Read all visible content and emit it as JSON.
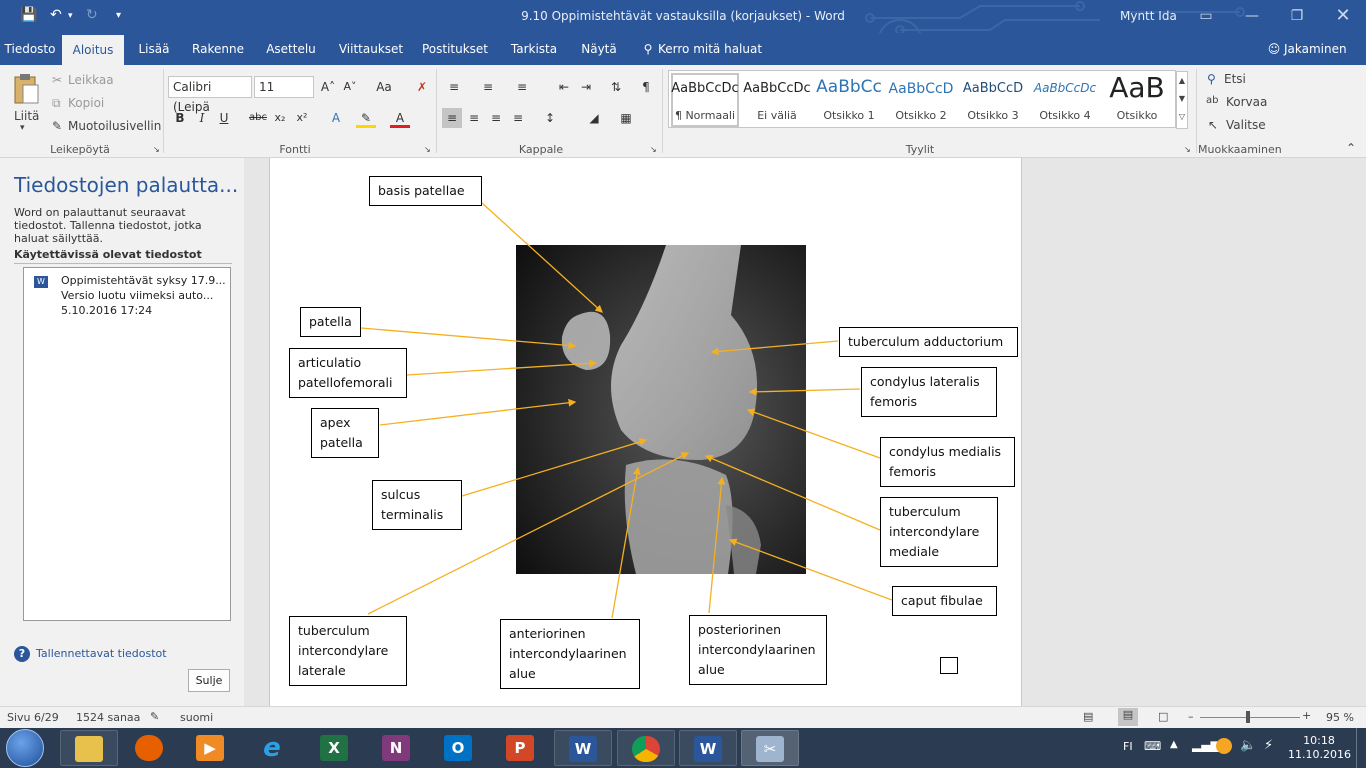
{
  "titlebar": {
    "title": "9.10 Oppimistehtävät vastauksilla (korjaukset) - Word",
    "user": "Myntt Ida",
    "save_icon": "save-icon",
    "undo_icon": "undo-icon",
    "redo_icon": "redo-icon"
  },
  "menu": {
    "tabs": [
      "Tiedosto",
      "Aloitus",
      "Lisää",
      "Rakenne",
      "Asettelu",
      "Viittaukset",
      "Postitukset",
      "Tarkista",
      "Näytä"
    ],
    "tell_me": "Kerro mitä haluat tehdä",
    "share": "Jakaminen",
    "active_tab": "Aloitus"
  },
  "ribbon": {
    "clipboard": {
      "paste": "Liitä",
      "cut": "Leikkaa",
      "copy": "Kopioi",
      "format_painter": "Muotoilusivellin",
      "label": "Leikepöytä"
    },
    "font": {
      "name": "Calibri (Leipä",
      "size": "11",
      "label": "Fontti",
      "change_case": "Aa"
    },
    "paragraph": {
      "label": "Kappale"
    },
    "styles": {
      "label": "Tyylit",
      "items": [
        {
          "preview": "AaBbCcDc",
          "name": "¶ Normaali",
          "color": "#000000"
        },
        {
          "preview": "AaBbCcDc",
          "name": "Ei väliä",
          "color": "#000000"
        },
        {
          "preview": "AaBbCc",
          "name": "Otsikko 1",
          "color": "#2e74b5"
        },
        {
          "preview": "AaBbCcD",
          "name": "Otsikko 2",
          "color": "#2e74b5"
        },
        {
          "preview": "AaBbCcD",
          "name": "Otsikko 3",
          "color": "#1f4e79"
        },
        {
          "preview": "AaBbCcDc",
          "name": "Otsikko 4",
          "color": "#2e74b5"
        },
        {
          "preview": "AaB",
          "name": "Otsikko",
          "color": "#000000"
        }
      ]
    },
    "editing": {
      "find": "Etsi",
      "replace": "Korvaa",
      "select": "Valitse",
      "label": "Muokkaaminen"
    }
  },
  "recovery": {
    "title": "Tiedostojen palautta...",
    "desc": "Word on palauttanut seuraavat tiedostot. Tallenna tiedostot, jotka haluat säilyttää.",
    "available_heading": "Käytettävissä olevat tiedostot",
    "file_name": "Oppimistehtävät syksy 17.9...",
    "file_version": "Versio luotu viimeksi auto...",
    "file_date": "5.10.2016 17:24",
    "help_link": "Tallennettavat tiedostot",
    "close_button": "Sulje"
  },
  "document": {
    "labels": {
      "basis_patellae": "basis patellae",
      "patella": "patella",
      "articulatio": "articulatio patellofemorali",
      "apex": "apex patella",
      "sulcus": "sulcus terminalis",
      "tub_lat": "tuberculum intercondylare laterale",
      "anterior": "anteriorinen intercondylaarinen alue",
      "posterior": "posteriorinen intercondylaarinen alue",
      "adductorium": "tuberculum adductorium",
      "cond_lat": "condylus lateralis femoris",
      "cond_med": "condylus medialis femoris",
      "tub_med": "tuberculum intercondylare mediale",
      "caput": "caput fibulae"
    }
  },
  "status": {
    "page": "Sivu 6/29",
    "words": "1524 sanaa",
    "language": "suomi",
    "zoom": "95 %"
  },
  "taskbar": {
    "language": "FI",
    "time": "10:18",
    "date": "11.10.2016"
  }
}
